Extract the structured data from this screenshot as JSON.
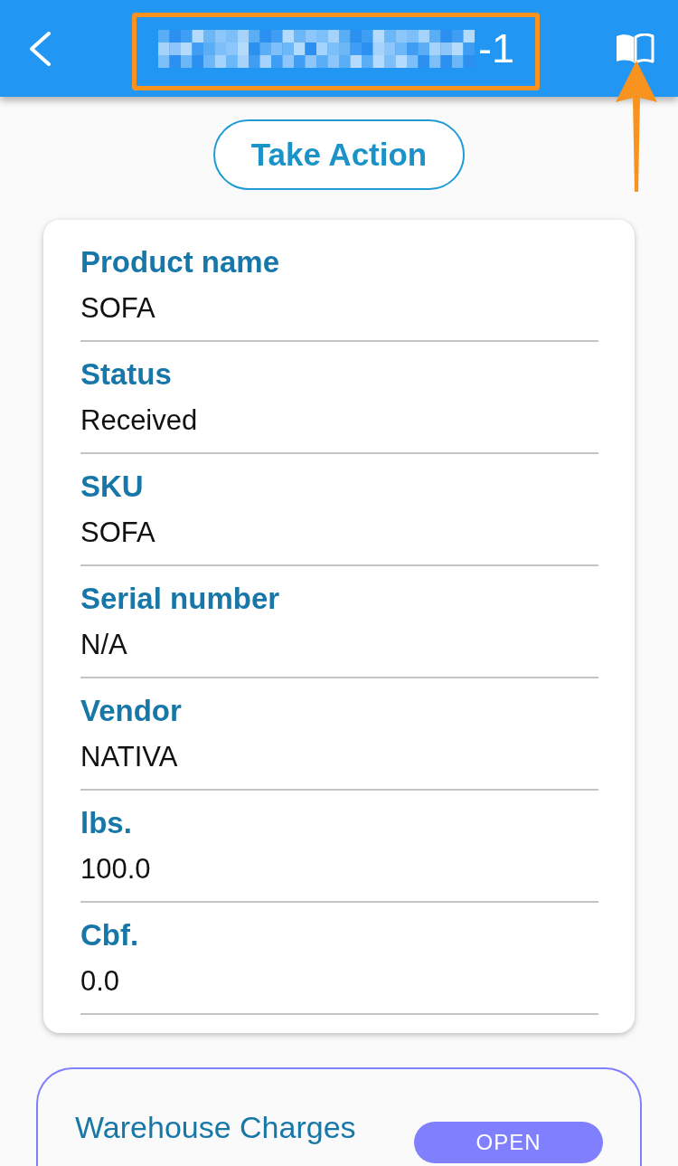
{
  "header": {
    "title": "-1"
  },
  "action_button": {
    "label": "Take Action"
  },
  "details": [
    {
      "label": "Product name",
      "value": "SOFA"
    },
    {
      "label": "Status",
      "value": "Received"
    },
    {
      "label": "SKU",
      "value": "SOFA"
    },
    {
      "label": "Serial number",
      "value": "N/A"
    },
    {
      "label": "Vendor",
      "value": "NATIVA"
    },
    {
      "label": "lbs.",
      "value": "100.0"
    },
    {
      "label": "Cbf.",
      "value": "0.0"
    }
  ],
  "warehouse_charges": {
    "title": "Warehouse Charges",
    "button": "OPEN"
  }
}
